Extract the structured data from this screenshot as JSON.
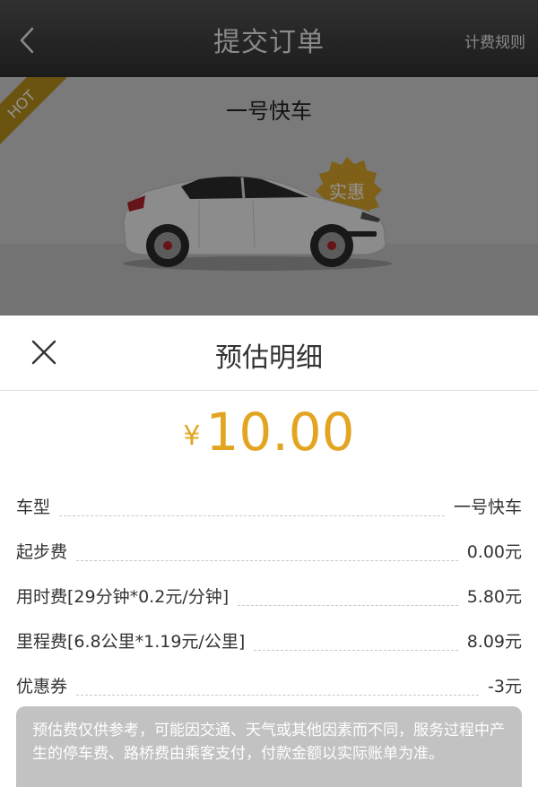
{
  "header": {
    "title": "提交订单",
    "rules_link": "计费规则"
  },
  "car_card": {
    "name": "一号快车",
    "ribbon": "HOT",
    "badge": "实惠"
  },
  "sheet": {
    "title": "预估明细",
    "currency": "¥",
    "amount": "10.00",
    "rows": [
      {
        "label": "车型",
        "value": "一号快车"
      },
      {
        "label": "起步费",
        "value": "0.00元"
      },
      {
        "label": "用时费[29分钟*0.2元/分钟]",
        "value": "5.80元"
      },
      {
        "label": "里程费[6.8公里*1.19元/公里]",
        "value": "8.09元"
      },
      {
        "label": "优惠券",
        "value": "-3元"
      }
    ],
    "notice": "预估费仅供参考，可能因交通、天气或其他因素而不同，服务过程中产生的停车费、路桥费由乘客支付，付款金额以实际账单为准。"
  },
  "colors": {
    "accent": "#e3a521",
    "header_bg": "#1c1c1c",
    "ribbon": "#b8901c"
  }
}
